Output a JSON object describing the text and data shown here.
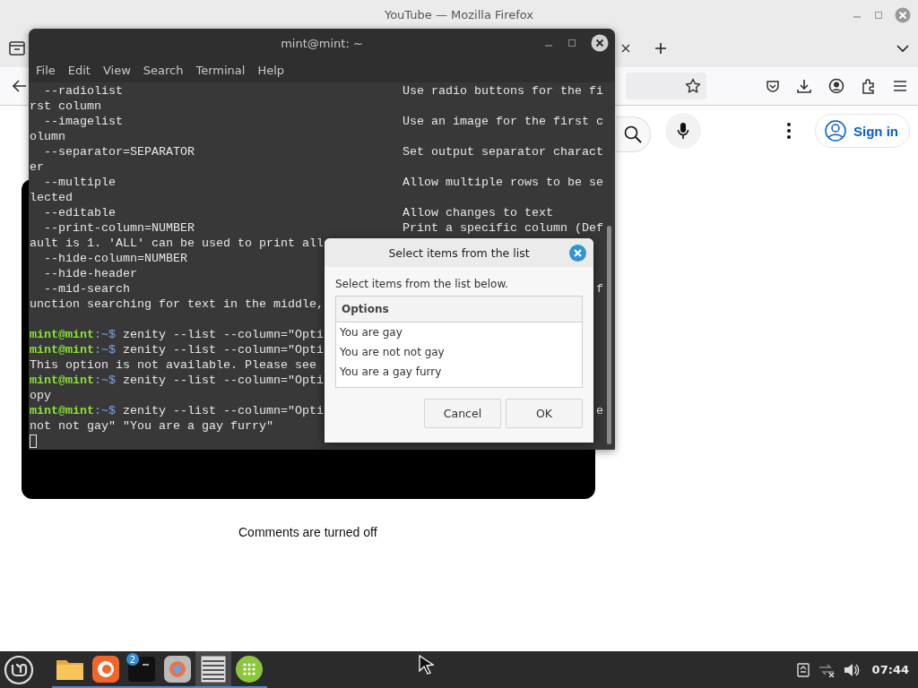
{
  "firefox": {
    "title": "YouTube — Mozilla Firefox",
    "sign_in": "Sign in",
    "comments_notice": "Comments are turned off"
  },
  "terminal": {
    "title": "mint@mint: ~",
    "menu": [
      "File",
      "Edit",
      "View",
      "Search",
      "Terminal",
      "Help"
    ],
    "cursor": true,
    "lines": [
      {
        "kind": "option",
        "option": "  --radiolist",
        "description": "Use radio buttons for the fi"
      },
      {
        "kind": "text",
        "text": "rst column"
      },
      {
        "kind": "option",
        "option": "  --imagelist",
        "description": "Use an image for the first c"
      },
      {
        "kind": "text",
        "text": "olumn"
      },
      {
        "kind": "option",
        "option": "  --separator=SEPARATOR",
        "description": "Set output separator charact"
      },
      {
        "kind": "text",
        "text": "er"
      },
      {
        "kind": "option",
        "option": "  --multiple",
        "description": "Allow multiple rows to be se"
      },
      {
        "kind": "text",
        "text": "lected"
      },
      {
        "kind": "option",
        "option": "  --editable",
        "description": "Allow changes to text"
      },
      {
        "kind": "option",
        "option": "  --print-column=NUMBER",
        "description": "Print a specific column (Def"
      },
      {
        "kind": "text",
        "text": "ault is 1. 'ALL' can be used to print all"
      },
      {
        "kind": "text",
        "text": "  --hide-column=NUMBER"
      },
      {
        "kind": "text",
        "text": "  --hide-header"
      },
      {
        "kind": "text",
        "text": "  --mid-search",
        "tail": "f"
      },
      {
        "kind": "text",
        "text": "unction searching for text in the middle,"
      },
      {
        "kind": "blank"
      },
      {
        "kind": "prompt",
        "user": "mint@mint",
        "path": ":~$",
        "command": "zenity --list --column=\"Opti"
      },
      {
        "kind": "prompt",
        "user": "mint@mint",
        "path": ":~$",
        "command": "zenity --list --column=\"Opti"
      },
      {
        "kind": "text",
        "text": "This option is not available. Please see"
      },
      {
        "kind": "prompt",
        "user": "mint@mint",
        "path": ":~$",
        "command": "zenity --list --column=\"Opti"
      },
      {
        "kind": "text",
        "text": "opy"
      },
      {
        "kind": "prompt",
        "user": "mint@mint",
        "path": ":~$",
        "command": "zenity --list --column=\"Opti",
        "tail": "e"
      },
      {
        "kind": "text",
        "text": "not not gay\" \"You are a gay furry\""
      }
    ]
  },
  "dialog": {
    "title": "Select items from the list",
    "prompt": "Select items from the list below.",
    "column": "Options",
    "rows": [
      {
        "label": "You are gay",
        "selected": false
      },
      {
        "label": "You are not not gay",
        "selected": false
      },
      {
        "label": "You are a gay furry",
        "selected": false
      }
    ],
    "buttons": [
      "Cancel",
      "OK"
    ]
  },
  "taskbar": {
    "apps": [
      {
        "kind": "folder",
        "selected": false
      },
      {
        "kind": "firefox",
        "selected": false
      },
      {
        "kind": "terminal",
        "selected": false,
        "badge": "2"
      },
      {
        "kind": "browser",
        "selected": false
      },
      {
        "kind": "list",
        "selected": true
      },
      {
        "kind": "grid",
        "selected": false
      }
    ],
    "clock": "07:44"
  }
}
